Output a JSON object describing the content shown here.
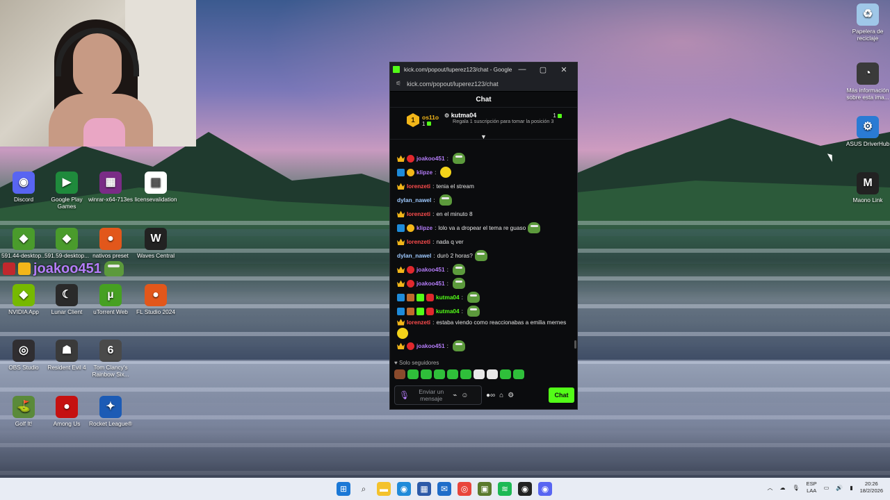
{
  "overlay": {
    "username": "joakoo451"
  },
  "desktop_icons_left": [
    {
      "label": "Discord",
      "color": "#5865f2",
      "glyph": "◉"
    },
    {
      "label": "Google Play Games",
      "color": "#1f8a3c",
      "glyph": "▶"
    },
    {
      "label": "winrar-x64-713es",
      "color": "#7a2c86",
      "glyph": "▦"
    },
    {
      "label": "licensevalidation",
      "color": "#ffffff",
      "glyph": "▤"
    },
    {
      "label": "591.44-desktop...",
      "color": "#4a9b2c",
      "glyph": "◆"
    },
    {
      "label": "591.59-desktop...",
      "color": "#4a9b2c",
      "glyph": "◆"
    },
    {
      "label": "nativos preset",
      "color": "#e2571b",
      "glyph": "●"
    },
    {
      "label": "Waves Central",
      "color": "#222222",
      "glyph": "W"
    },
    {
      "label": "NVIDIA App",
      "color": "#76b900",
      "glyph": "◆"
    },
    {
      "label": "Lunar Client",
      "color": "#2a2a2a",
      "glyph": "☾"
    },
    {
      "label": "uTorrent Web",
      "color": "#46a022",
      "glyph": "µ"
    },
    {
      "label": "FL Studio 2024",
      "color": "#e2571b",
      "glyph": "●"
    },
    {
      "label": "OBS Studio",
      "color": "#302e31",
      "glyph": "◎"
    },
    {
      "label": "Resident Evil 4",
      "color": "#3a3a3a",
      "glyph": "☗"
    },
    {
      "label": "Tom Clancy's Rainbow Six...",
      "color": "#4a4a4a",
      "glyph": "6"
    },
    {
      "label": "Golf It!",
      "color": "#5a8a3a",
      "glyph": "⛳"
    },
    {
      "label": "Among Us",
      "color": "#c51111",
      "glyph": "●"
    },
    {
      "label": "Rocket League®",
      "color": "#1c5bb5",
      "glyph": "✦"
    }
  ],
  "desktop_icons_right": [
    {
      "label": "Papelera de reciclaje",
      "color": "#9fc7e8",
      "glyph": "♻"
    },
    {
      "label": "Más información sobre esta ima...",
      "color": "#3a3a3a",
      "glyph": "◔"
    },
    {
      "label": "ASUS DriverHub",
      "color": "#2a7bd4",
      "glyph": "⚙"
    },
    {
      "label": "Maono Link",
      "color": "#222222",
      "glyph": "M"
    }
  ],
  "window": {
    "title": "kick.com/popout/luperez123/chat - Google...",
    "url": "kick.com/popout/luperez123/chat",
    "minimize": "—",
    "maximize": "▢",
    "close": "✕",
    "header": "Chat",
    "pinned": {
      "rank": "1",
      "left_user": "os11o",
      "left_count": "1",
      "right_user": "kutma04",
      "right_desc": "Regala 1 suscripción para tomar la posición 3",
      "right_count": "1"
    },
    "messages": [
      {
        "user": "joakoo451",
        "color": "#b57dfa",
        "badges": [
          "crown",
          "red"
        ],
        "text": "",
        "emote": "frog"
      },
      {
        "user": "klipze",
        "color": "#b57dfa",
        "badges": [
          "blue",
          "gold"
        ],
        "text": "",
        "emote": "yellow"
      },
      {
        "user": "lorenzeti",
        "color": "#ff4d4d",
        "badges": [
          "crown"
        ],
        "text": "tenia el stream",
        "emote": ""
      },
      {
        "user": "dylan_nawel",
        "color": "#9ec9ff",
        "badges": [],
        "text": "",
        "emote": "frog"
      },
      {
        "user": "lorenzeti",
        "color": "#ff4d4d",
        "badges": [
          "crown"
        ],
        "text": "en el minuto 8",
        "emote": ""
      },
      {
        "user": "klipze",
        "color": "#b57dfa",
        "badges": [
          "blue",
          "gold"
        ],
        "text": "lolo va a dropear el tema re guaso",
        "emote": "frog"
      },
      {
        "user": "lorenzeti",
        "color": "#ff4d4d",
        "badges": [
          "crown"
        ],
        "text": "nada q ver",
        "emote": ""
      },
      {
        "user": "dylan_nawel",
        "color": "#9ec9ff",
        "badges": [],
        "text": "durò 2 horas?",
        "emote": "frog"
      },
      {
        "user": "joakoo451",
        "color": "#b57dfa",
        "badges": [
          "crown",
          "red"
        ],
        "text": "",
        "emote": "frog"
      },
      {
        "user": "joakoo451",
        "color": "#b57dfa",
        "badges": [
          "crown",
          "red"
        ],
        "text": "",
        "emote": "frog"
      },
      {
        "user": "kutma04",
        "color": "#53fc18",
        "badges": [
          "blue",
          "og",
          "green",
          "sub"
        ],
        "text": "",
        "emote": "frog"
      },
      {
        "user": "kutma04",
        "color": "#53fc18",
        "badges": [
          "blue",
          "og",
          "green",
          "sub"
        ],
        "text": "",
        "emote": "frog"
      },
      {
        "user": "lorenzeti",
        "color": "#ff4d4d",
        "badges": [
          "crown"
        ],
        "text": "estaba viendo como reaccionabas a emilia mernes",
        "emote": "yellow"
      },
      {
        "user": "joakoo451",
        "color": "#b57dfa",
        "badges": [
          "crown",
          "red"
        ],
        "text": "",
        "emote": "frog"
      }
    ],
    "followers_only": "Solo seguidores",
    "input_placeholder": "Enviar un mensaje",
    "send_label": "Chat"
  },
  "taskbar": {
    "lang_1": "ESP",
    "lang_2": "LAA",
    "time": "20:26",
    "date": "18/2/2026"
  }
}
